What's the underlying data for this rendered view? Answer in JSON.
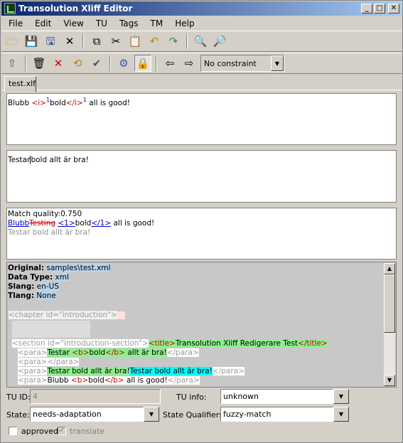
{
  "window": {
    "title": "Transolution Xliff Editor"
  },
  "menu": [
    "File",
    "Edit",
    "View",
    "TU",
    "Tags",
    "TM",
    "Help"
  ],
  "toolbar1": {
    "icons": [
      "open-icon",
      "save-icon",
      "save-as-icon",
      "close-file-icon",
      "copy-icon",
      "cut-icon",
      "paste-icon",
      "undo-icon",
      "redo-icon",
      "find-icon",
      "find-replace-icon"
    ]
  },
  "toolbar2": {
    "icons": [
      "up-arrow-icon",
      "delete-icon",
      "reject-icon",
      "refresh-icon",
      "accept-icon",
      "tm-icon",
      "lock-icon",
      "previous-icon",
      "next-icon"
    ],
    "constraint": "No constraint"
  },
  "tab": {
    "label": "test.xlf"
  },
  "source": {
    "before": "Blubb ",
    "tag_open": "<i>",
    "tag_open_num": "1",
    "bold": "bold",
    "tag_close": "</i>",
    "tag_close_num": "1",
    "after": " all is good!"
  },
  "target": {
    "before_caret": "Testar",
    "after_caret": "bold allt är bra!"
  },
  "match": {
    "quality_label": "Match quality:",
    "quality_value": "0.750",
    "word_new": "Blubb",
    "word_old": "Testing",
    "space": " ",
    "tag1": "<1>",
    "bold": "bold",
    "tag2": "</1>",
    "rest": " all is good!",
    "target_suggestion": "Testar bold allt är bra!"
  },
  "document": {
    "original_label": "Original:",
    "original_value": "samples\\test.xml",
    "datatype_label": "Data Type:",
    "datatype_value": "xml",
    "slang_label": "Slang:",
    "slang_value": "en-US",
    "tlang_label": "Tlang:",
    "tlang_value": "None",
    "chapter": "<chapter id=\"introduction\">",
    "section": "<section id=\"introduction-section\">",
    "title_open": "<title>",
    "title_text": "Transolution Xliff Redigerare Test",
    "title_close": "</title>",
    "para_open": "<para>",
    "para_close": "</para>",
    "p1_a": "Testar ",
    "b_open": "<b>",
    "p1_b": "bold",
    "b_close": "</b>",
    "p1_c": " allt är bra!",
    "p3_green": "Testar bold allt är bra!",
    "p3_cyan": "Testar bold allt är bra!",
    "p4_a": "Blubb ",
    "p4_c": " all is good!"
  },
  "form": {
    "tu_id_label": "TU ID:",
    "tu_id_value": "4",
    "tu_info_label": "TU info:",
    "tu_info_value": "unknown",
    "state_label": "State:",
    "state_value": "needs-adaptation",
    "state_qual_label": "State Qualifiers:",
    "state_qual_value": "fuzzy-match",
    "approved_label": "approved",
    "translate_label": "translate",
    "translate_checked": true
  }
}
